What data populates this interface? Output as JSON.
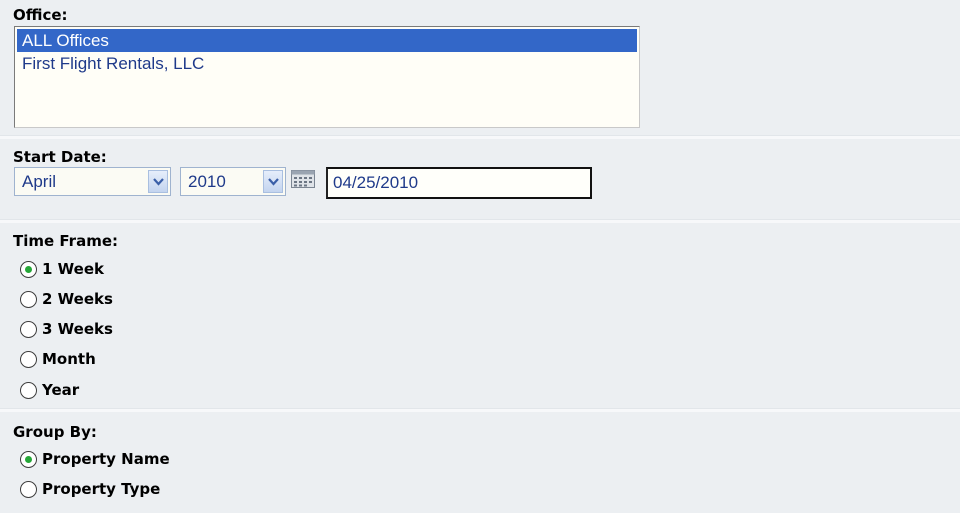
{
  "office": {
    "label": "Office:",
    "options": [
      {
        "text": "ALL Offices",
        "selected": true
      },
      {
        "text": "First Flight Rentals, LLC",
        "selected": false
      }
    ]
  },
  "start_date": {
    "label": "Start Date:",
    "month": "April",
    "year": "2010",
    "date_value": "04/25/2010"
  },
  "time_frame": {
    "label": "Time Frame:",
    "options": [
      {
        "text": "1 Week",
        "checked": true
      },
      {
        "text": "2 Weeks",
        "checked": false
      },
      {
        "text": "3 Weeks",
        "checked": false
      },
      {
        "text": "Month",
        "checked": false
      },
      {
        "text": "Year",
        "checked": false
      }
    ]
  },
  "group_by": {
    "label": "Group By:",
    "options": [
      {
        "text": "Property Name",
        "checked": true
      },
      {
        "text": "Property Type",
        "checked": false
      }
    ]
  },
  "colors": {
    "background": "#eceff2",
    "selection": "#3367c8",
    "radio_dot": "#25a637",
    "option_text": "#1f3a8a"
  },
  "icons": {
    "calendar": "calendar-icon",
    "dropdown": "chevron-down-icon"
  }
}
